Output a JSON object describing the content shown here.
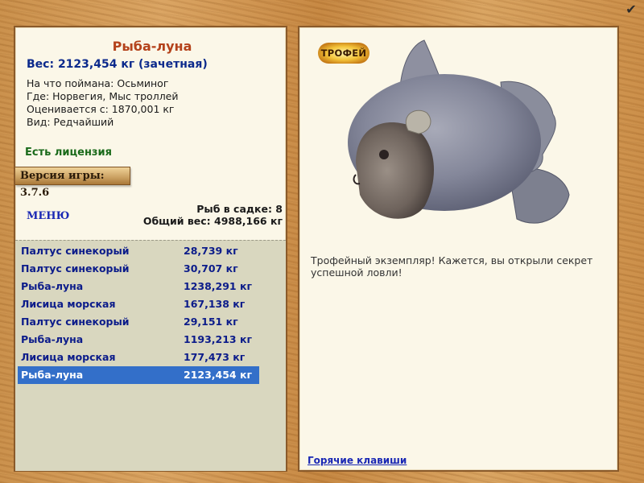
{
  "window": {
    "confirm_icon": "checkmark-icon",
    "confirm_glyph": "✔"
  },
  "fish": {
    "name": "Рыба-луна",
    "weight_line": "Вес: 2123,454 кг (зачетная)",
    "bait_line": "На что поймана: Осьминог",
    "location_line": "Где: Норвегия, Мыс троллей",
    "rated_line": "Оценивается с: 1870,001 кг",
    "kind_line": "Вид: Редчайший"
  },
  "license": "Есть лицензия",
  "version": "Версия игры: 3.7.6",
  "menu": "МЕНЮ",
  "cage": {
    "count_line": "Рыб в садке: 8",
    "total_line": "Общий вес: 4988,166 кг"
  },
  "catch_list": [
    {
      "name": "Палтус синекорый",
      "weight": "28,739 кг"
    },
    {
      "name": "Палтус синекорый",
      "weight": "30,707 кг"
    },
    {
      "name": "Рыба-луна",
      "weight": "1238,291 кг"
    },
    {
      "name": "Лисица морская",
      "weight": "167,138 кг"
    },
    {
      "name": "Палтус синекорый",
      "weight": "29,151 кг"
    },
    {
      "name": "Рыба-луна",
      "weight": "1193,213 кг"
    },
    {
      "name": "Лисица морская",
      "weight": "177,473 кг"
    },
    {
      "name": "Рыба-луна",
      "weight": "2123,454 кг"
    }
  ],
  "selected_index": 7,
  "trophy_badge": "ТРОФЕЙ",
  "description": "Трофейный экземпляр! Кажется, вы открыли секрет успешной ловли!",
  "hotkeys": "Горячие клавиши",
  "colors": {
    "title": "#b4421b",
    "weight": "#0c2a8c",
    "license": "#1a6a1a",
    "link": "#1a28b4",
    "selection": "#336fc9",
    "list_bg": "#d9d7bf",
    "panel_bg": "#fbf7e8"
  }
}
